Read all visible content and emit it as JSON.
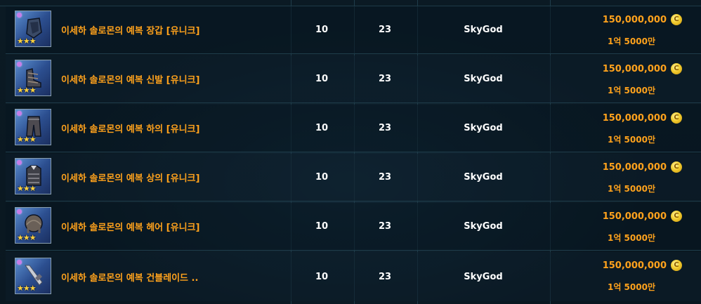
{
  "rows": [
    {
      "name": "이세하 솔로몬의 예복 장갑 [유니크]",
      "level": "10",
      "count": "23",
      "seller": "SkyGod",
      "price": "150,000,000",
      "price_korean": "1억 5000만",
      "icon": "gloves-icon",
      "stars": "★★★"
    },
    {
      "name": "이세하 솔로몬의 예복 신발 [유니크]",
      "level": "10",
      "count": "23",
      "seller": "SkyGod",
      "price": "150,000,000",
      "price_korean": "1억 5000만",
      "icon": "shoes-icon",
      "stars": "★★★"
    },
    {
      "name": "이세하 솔로몬의 예복 하의 [유니크]",
      "level": "10",
      "count": "23",
      "seller": "SkyGod",
      "price": "150,000,000",
      "price_korean": "1억 5000만",
      "icon": "pants-icon",
      "stars": "★★★"
    },
    {
      "name": "이세하 솔로몬의 예복 상의 [유니크]",
      "level": "10",
      "count": "23",
      "seller": "SkyGod",
      "price": "150,000,000",
      "price_korean": "1억 5000만",
      "icon": "top-icon",
      "stars": "★★★"
    },
    {
      "name": "이세하 솔로몬의 예복 헤어 [유니크]",
      "level": "10",
      "count": "23",
      "seller": "SkyGod",
      "price": "150,000,000",
      "price_korean": "1억 5000만",
      "icon": "hair-icon",
      "stars": "★★★"
    },
    {
      "name": "이세하 솔로몬의 예복 건블레이드 ..",
      "level": "10",
      "count": "23",
      "seller": "SkyGod",
      "price": "150,000,000",
      "price_korean": "1억 5000만",
      "icon": "gunblade-icon",
      "stars": "★★★"
    }
  ],
  "coin_glyph": "C",
  "colors": {
    "item_name": "#ffa21c",
    "price": "#ffa21c",
    "text": "#ffffff",
    "row_border": "#1f3d4b"
  }
}
